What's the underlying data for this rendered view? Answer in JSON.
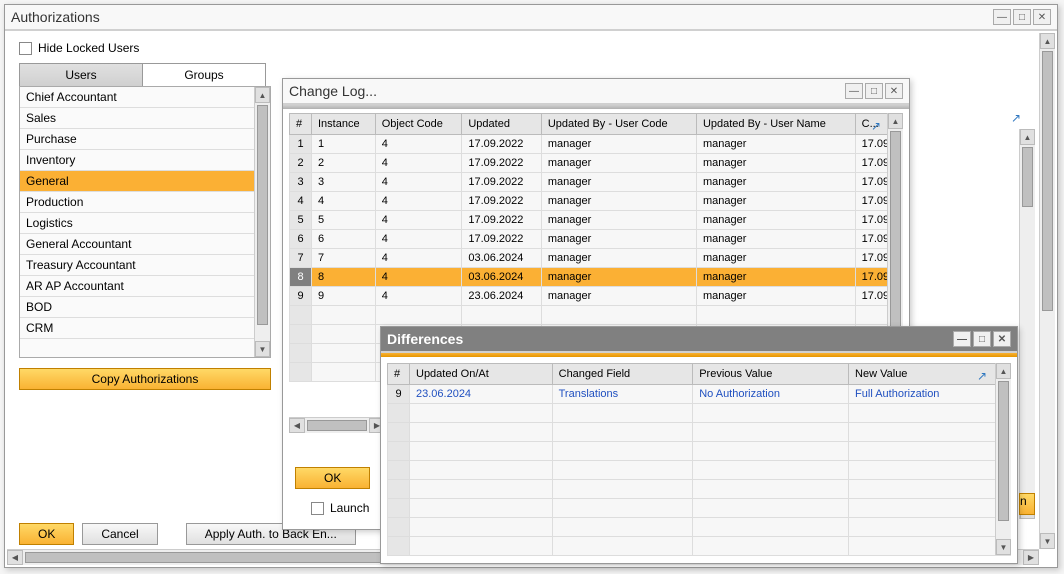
{
  "main": {
    "title": "Authorizations",
    "hide_locked": "Hide Locked Users",
    "tabs": {
      "users": "Users",
      "groups": "Groups"
    },
    "list": [
      "Chief Accountant",
      "Sales",
      "Purchase",
      "Inventory",
      "General",
      "Production",
      "Logistics",
      "General Accountant",
      "Treasury Accountant",
      "AR AP Accountant",
      "BOD",
      "CRM"
    ],
    "selected_index": 4,
    "copy_button": "Copy Authorizations",
    "buttons": {
      "ok": "OK",
      "cancel": "Cancel",
      "apply": "Apply Auth. to Back En..."
    },
    "launch": "Launch"
  },
  "changelog": {
    "title": "Change Log...",
    "columns": [
      "#",
      "Instance",
      "Object Code",
      "Updated",
      "Updated By - User Code",
      "Updated By - User Name",
      "C..."
    ],
    "rows": [
      {
        "n": "1",
        "instance": "1",
        "code": "4",
        "updated": "17.09.2022",
        "ucode": "manager",
        "uname": "manager",
        "c": "17.09"
      },
      {
        "n": "2",
        "instance": "2",
        "code": "4",
        "updated": "17.09.2022",
        "ucode": "manager",
        "uname": "manager",
        "c": "17.09"
      },
      {
        "n": "3",
        "instance": "3",
        "code": "4",
        "updated": "17.09.2022",
        "ucode": "manager",
        "uname": "manager",
        "c": "17.09"
      },
      {
        "n": "4",
        "instance": "4",
        "code": "4",
        "updated": "17.09.2022",
        "ucode": "manager",
        "uname": "manager",
        "c": "17.09"
      },
      {
        "n": "5",
        "instance": "5",
        "code": "4",
        "updated": "17.09.2022",
        "ucode": "manager",
        "uname": "manager",
        "c": "17.09"
      },
      {
        "n": "6",
        "instance": "6",
        "code": "4",
        "updated": "17.09.2022",
        "ucode": "manager",
        "uname": "manager",
        "c": "17.09"
      },
      {
        "n": "7",
        "instance": "7",
        "code": "4",
        "updated": "03.06.2024",
        "ucode": "manager",
        "uname": "manager",
        "c": "17.09"
      },
      {
        "n": "8",
        "instance": "8",
        "code": "4",
        "updated": "03.06.2024",
        "ucode": "manager",
        "uname": "manager",
        "c": "17.09"
      },
      {
        "n": "9",
        "instance": "9",
        "code": "4",
        "updated": "23.06.2024",
        "ucode": "manager",
        "uname": "manager",
        "c": "17.09"
      }
    ],
    "selected_row": 7,
    "ok": "OK"
  },
  "diff": {
    "title": "Differences",
    "columns": [
      "#",
      "Updated On/At",
      "Changed Field",
      "Previous Value",
      "New Value"
    ],
    "rows": [
      {
        "n": "9",
        "updated": "23.06.2024",
        "field": "Translations",
        "prev": "No Authorization",
        "new": "Full Authorization"
      }
    ]
  }
}
